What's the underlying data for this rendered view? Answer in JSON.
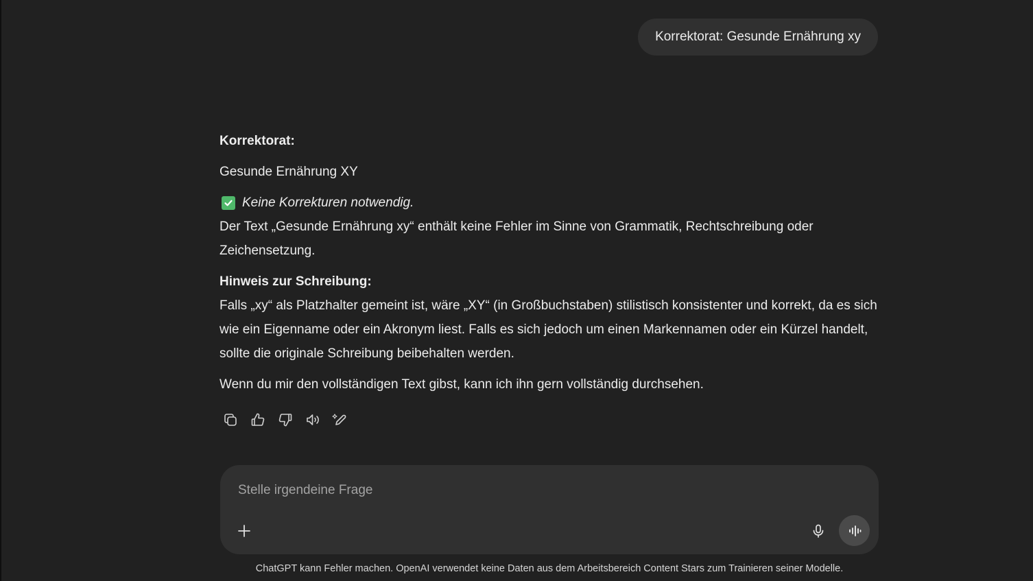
{
  "user_message": {
    "text": "Korrektorat: Gesunde Ernährung xy"
  },
  "assistant_message": {
    "heading": "Korrektorat:",
    "title_line": "Gesunde Ernährung XY",
    "check_text": "Keine Korrekturen notwendig.",
    "check_icon": "check-mark-emoji",
    "explanation": "Der Text „Gesunde Ernährung xy“ enthält keine Fehler im Sinne von Grammatik, Rechtschreibung oder Zeichensetzung.",
    "note_heading": "Hinweis zur Schreibung:",
    "note_text": "Falls „xy“ als Platzhalter gemeint ist, wäre „XY“ (in Großbuchstaben) stilistisch konsistenter und korrekt, da es sich wie ein Eigenname oder ein Akronym liest. Falls es sich jedoch um einen Markennamen oder ein Kürzel handelt, sollte die originale Schreibung beibehalten werden.",
    "closing": "Wenn du mir den vollständigen Text gibst, kann ich ihn gern vollständig durchsehen."
  },
  "message_actions": [
    {
      "icon": "copy-icon"
    },
    {
      "icon": "thumbs-up-icon"
    },
    {
      "icon": "thumbs-down-icon"
    },
    {
      "icon": "read-aloud-icon"
    },
    {
      "icon": "edit-icon"
    }
  ],
  "composer": {
    "placeholder": "Stelle irgendeine Frage",
    "value": "",
    "plus_icon": "plus-icon",
    "mic_icon": "microphone-icon",
    "voice_icon": "voice-mode-icon"
  },
  "footer": {
    "disclaimer": "ChatGPT kann Fehler machen. OpenAI verwendet keine Daten aus dem Arbeitsbereich Content Stars zum Trainieren seiner Modelle."
  },
  "colors": {
    "background": "#212121",
    "bubble": "#303030",
    "text": "#ececec",
    "check_green": "#4fb86a"
  }
}
